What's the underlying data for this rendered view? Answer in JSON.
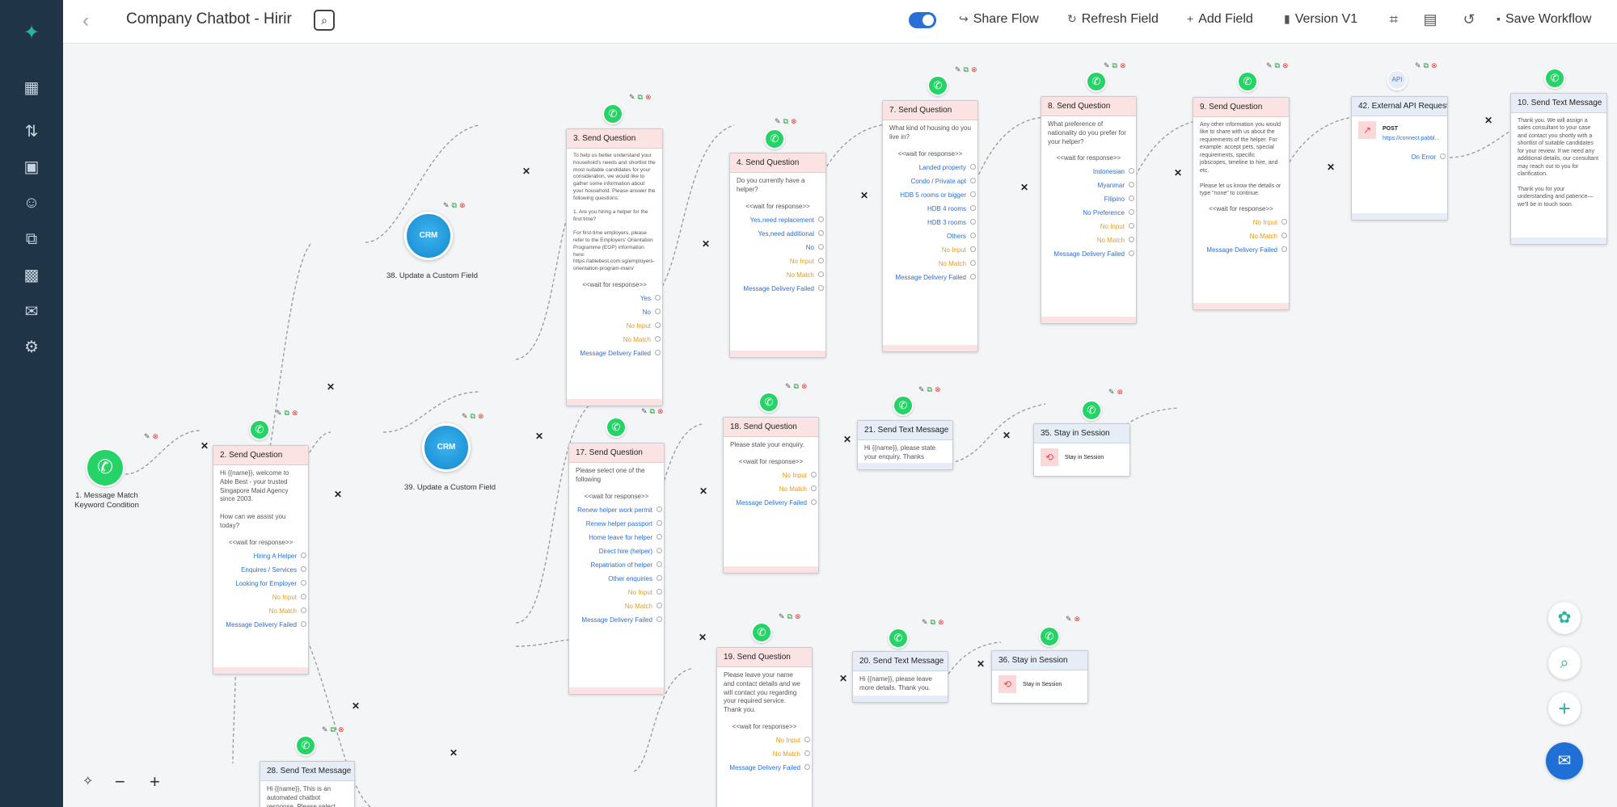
{
  "header": {
    "title": "Company Chatbot - Hirir",
    "share": "Share Flow",
    "refresh": "Refresh Field",
    "add": "Add Field",
    "version": "Version V1",
    "save": "Save Workflow"
  },
  "nodes": {
    "n1": "1. Message Match Keyword Condition",
    "n2": {
      "title": "2. Send Question",
      "body": "Hi {{name}}, welcome to Able Best - your trusted Singapore Maid Agency since 2003.\n\nHow can we assist you today?",
      "wait": "<<wait for response>>",
      "opts": [
        "Hiring A Helper",
        "Enquires / Services",
        "Looking for Employer",
        "No Input",
        "No Match",
        "Message Delivery Failed"
      ]
    },
    "n3": {
      "title": "3. Send Question",
      "body": "To help us better understand your household's needs and shortlist the most suitable candidates for your consideration, we would like to gather some information about your household. Please answer the following questions:\n\n1. Are you hiring a helper for the first time?\n\nFor first-time employers, please refer to the Employers' Orientation Programme (EOP) information here: https://ablebest.com.sg/employers-orientation-program-main/",
      "wait": "<<wait for response>>",
      "opts": [
        "Yes",
        "No",
        "No Input",
        "No Match",
        "Message Delivery Failed"
      ]
    },
    "n4": {
      "title": "4. Send Question",
      "body": "Do you currently have a helper?",
      "wait": "<<wait for response>>",
      "opts": [
        "Yes,need replacement",
        "Yes,need additional",
        "No",
        "No Input",
        "No Match",
        "Message Delivery Failed"
      ]
    },
    "n7": {
      "title": "7. Send Question",
      "body": "What kind of housing do you live in?",
      "wait": "<<wait for response>>",
      "opts": [
        "Landed property",
        "Condo / Private apt",
        "HDB 5 rooms or bigger",
        "HDB 4 rooms",
        "HDB 3 rooms",
        "Others",
        "No Input",
        "No Match",
        "Message Delivery Failed"
      ]
    },
    "n8": {
      "title": "8. Send Question",
      "body": "What preference of nationality do you prefer for your helper?",
      "wait": "<<wait for response>>",
      "opts": [
        "Indonesian",
        "Myanmar",
        "Filipino",
        "No Preference",
        "No Input",
        "No Match",
        "Message Delivery Failed"
      ]
    },
    "n9": {
      "title": "9. Send Question",
      "body": "Any other information you would like to share with us about the requirements of the helper. For example: accept pets, special requirements, specific jobscopes, timeline to hire, and etc.\n\nPlease let us know the details or type \"none\" to continue.",
      "wait": "<<wait for response>>",
      "opts": [
        "No Input",
        "No Match",
        "Message Delivery Failed"
      ]
    },
    "n42": {
      "title": "42. External API Request",
      "method": "POST",
      "url": "https://connect.pabbl...",
      "err": "On Error",
      "badge": "API"
    },
    "n10": {
      "title": "10. Send Text Message",
      "body": "Thank you. We will assign a sales consultant to your case and contact you shortly with a shortlist of suitable candidates for your review. If we need any additional details, our consultant may reach out to you for clarification.\n\nThank you for your understanding and patience—we'll be in touch soon."
    },
    "n38": "38. Update a Custom Field",
    "n39": "39. Update a Custom Field",
    "crm": "CRM",
    "n17": {
      "title": "17. Send Question",
      "body": "Please select one of the following",
      "wait": "<<wait for response>>",
      "opts": [
        "Renew helper work permit",
        "Renew helper passport",
        "Home leave for helper",
        "Direct hire (helper)",
        "Repatriation of helper",
        "Other enquiries",
        "No Input",
        "No Match",
        "Message Delivery Failed"
      ]
    },
    "n18": {
      "title": "18. Send Question",
      "body": "Please state your enquiry.",
      "wait": "<<wait for response>>",
      "opts": [
        "No Input",
        "No Match",
        "Message Delivery Failed"
      ]
    },
    "n21": {
      "title": "21. Send Text Message",
      "body": "Hi {{name}}, please state your enquiry. Thanks"
    },
    "n35": {
      "title": "35. Stay in Session",
      "body": "Stay in Session"
    },
    "n19": {
      "title": "19. Send Question",
      "body": "Please leave your name and contact details and we will contact you regarding your required service. Thank you.",
      "wait": "<<wait for response>>",
      "opts": [
        "No Input",
        "No Match",
        "Message Delivery Failed"
      ]
    },
    "n20": {
      "title": "20. Send Text Message",
      "body": "Hi {{name}}, please leave more details. Thank you."
    },
    "n36": {
      "title": "36. Stay in Session",
      "body": "Stay in Session"
    },
    "n28": {
      "title": "28. Send Text Message",
      "body": "Hi {{name}}, This is an automated chatbot response. Please select one of the buttons for our assistance."
    }
  },
  "zoom": {
    "minus": "−",
    "plus": "+"
  },
  "colors": {
    "sidebar": "#1f3446",
    "accent": "#2a6fd6",
    "whatsapp": "#25d366",
    "crm": "#1289d0",
    "option_orange": "#e89a1d"
  },
  "icons": [
    "search-icon",
    "share-icon",
    "refresh-icon",
    "add-icon",
    "version-icon",
    "qr-icon",
    "document-icon",
    "history-icon",
    "save-icon",
    "whatsapp-icon",
    "edit-icon",
    "copy-icon",
    "delete-icon",
    "scissors-icon"
  ]
}
